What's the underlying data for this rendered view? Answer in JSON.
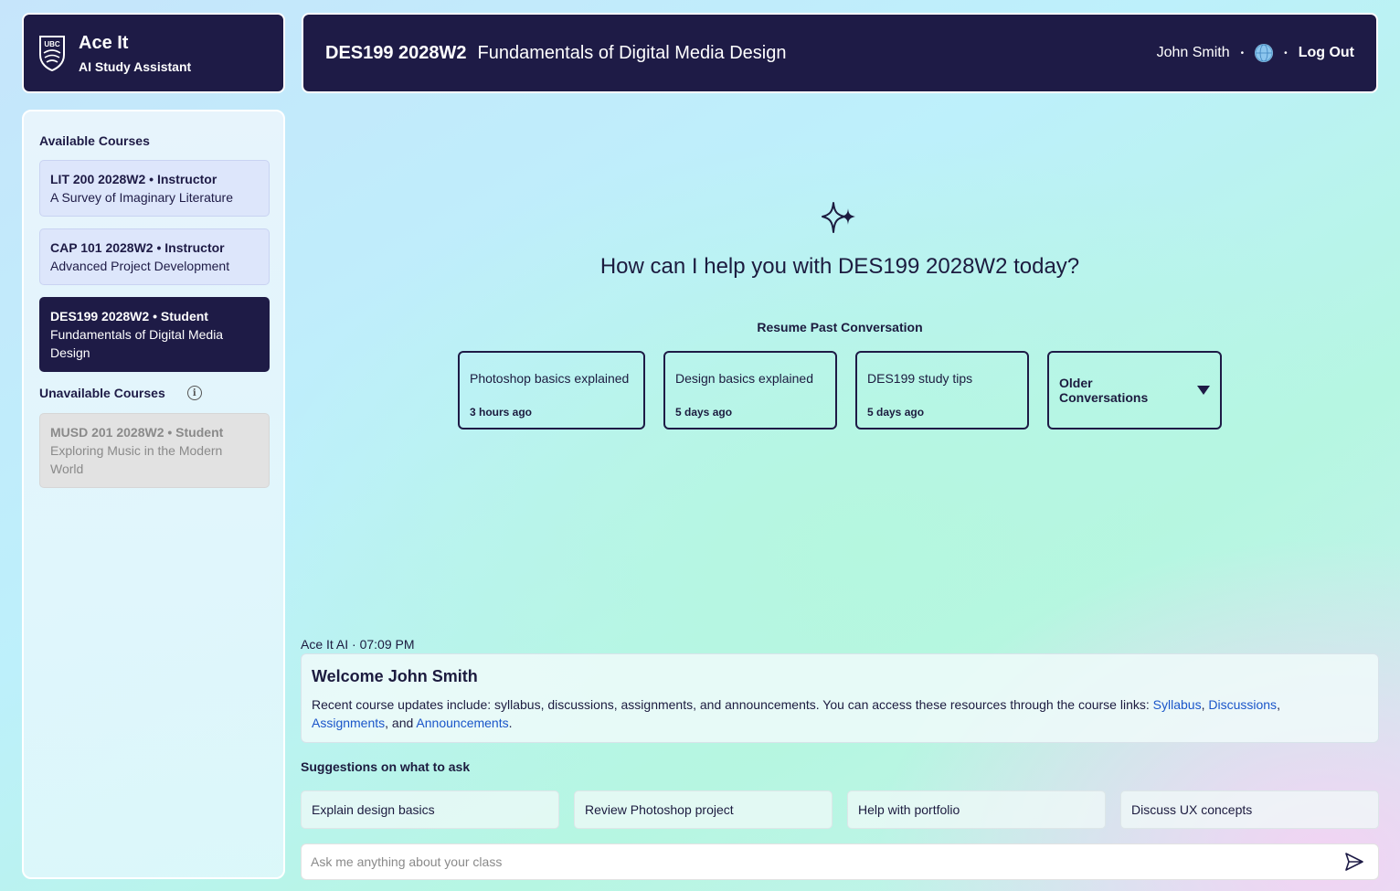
{
  "brand": {
    "name": "Ace It",
    "subtitle": "AI Study Assistant",
    "logo_text": "UBC"
  },
  "header": {
    "course_code": "DES199 2028W2",
    "course_title": "Fundamentals of Digital Media Design",
    "user_name": "John Smith",
    "separator": "•",
    "logout_label": "Log Out"
  },
  "sidebar": {
    "available_heading": "Available Courses",
    "available": [
      {
        "head": "LIT 200 2028W2 • Instructor",
        "title": "A Survey of Imaginary Literature"
      },
      {
        "head": "CAP 101 2028W2 • Instructor",
        "title": "Advanced Project Development"
      },
      {
        "head": "DES199 2028W2 • Student",
        "title": "Fundamentals of Digital Media Design"
      }
    ],
    "unavailable_heading": "Unavailable Courses",
    "unavailable": [
      {
        "head": "MUSD 201 2028W2 • Student",
        "title": "Exploring Music in the Modern World"
      }
    ]
  },
  "main": {
    "greeting": "How can I help you with DES199 2028W2 today?",
    "resume_title": "Resume Past Conversation",
    "conversations": [
      {
        "title": "Photoshop basics explained",
        "time": "3 hours ago"
      },
      {
        "title": "Design basics explained",
        "time": "5 days ago"
      },
      {
        "title": "DES199 study tips",
        "time": "5 days ago"
      }
    ],
    "older_label": "Older Conversations"
  },
  "message": {
    "meta": "Ace It AI · 07:09 PM",
    "title": "Welcome John Smith",
    "body_prefix": "Recent course updates include: syllabus, discussions, assignments, and announcements. You can access these resources through the course links: ",
    "links": [
      "Syllabus",
      "Discussions",
      "Assignments",
      "Announcements"
    ],
    "sep_comma": ", ",
    "sep_and": ", and ",
    "end": "."
  },
  "suggestions": {
    "title": "Suggestions on what to ask",
    "items": [
      "Explain design basics",
      "Review Photoshop project",
      "Help with portfolio",
      "Discuss UX concepts"
    ]
  },
  "input": {
    "placeholder": "Ask me anything about your class"
  },
  "colors": {
    "navy": "#1e1b46",
    "link": "#1a55c9",
    "active_card": "#1e1b46",
    "available_card": "#dde6fb"
  }
}
